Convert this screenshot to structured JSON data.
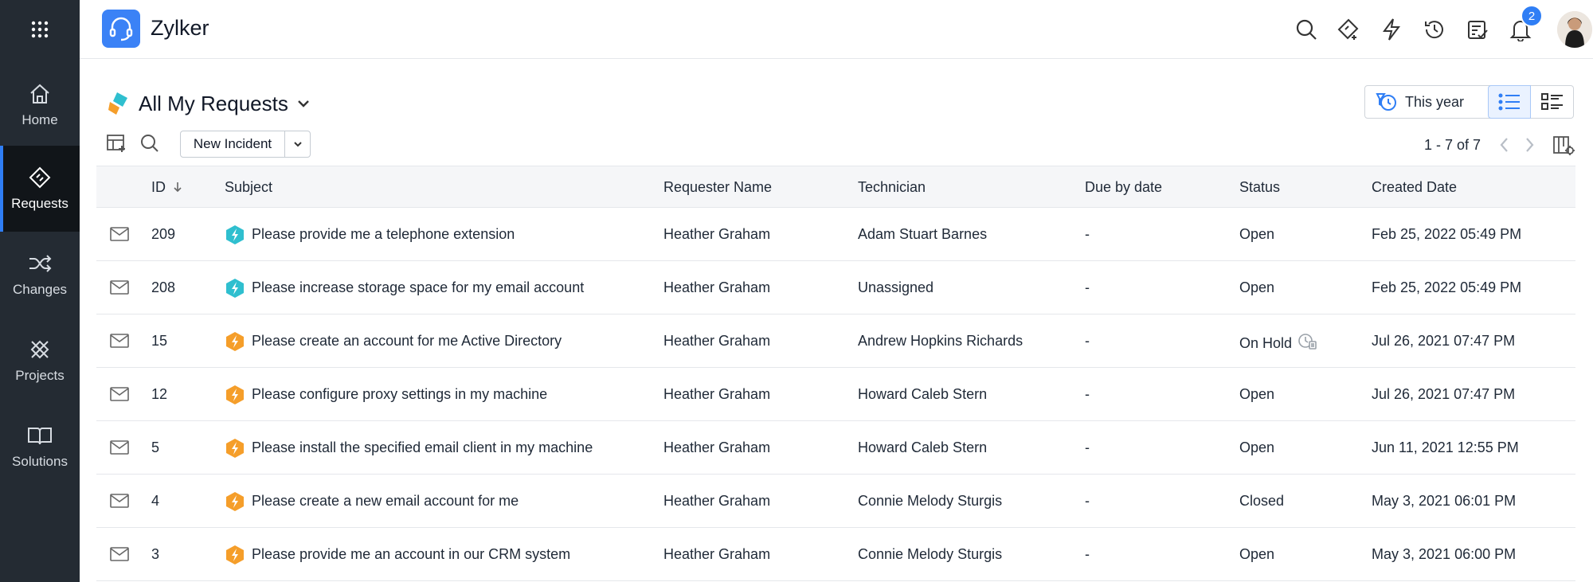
{
  "sidebar": {
    "items": [
      {
        "label": "Home"
      },
      {
        "label": "Requests"
      },
      {
        "label": "Changes"
      },
      {
        "label": "Projects"
      },
      {
        "label": "Solutions"
      }
    ]
  },
  "header": {
    "brand": "Zylker",
    "notification_count": "2"
  },
  "view": {
    "title": "All My Requests",
    "filter_label": "This year",
    "new_button": "New Incident",
    "pager": "1 - 7 of 7"
  },
  "table": {
    "columns": [
      "ID",
      "Subject",
      "Requester Name",
      "Technician",
      "Due by date",
      "Status",
      "Created Date"
    ],
    "rows": [
      {
        "id": "209",
        "subject": "Please provide me a telephone extension",
        "requester": "Heather Graham",
        "technician": "Adam Stuart Barnes",
        "due": "-",
        "status": "Open",
        "created": "Feb 25, 2022 05:49 PM",
        "type": "teal"
      },
      {
        "id": "208",
        "subject": "Please increase storage space for my email account",
        "requester": "Heather Graham",
        "technician": "Unassigned",
        "due": "-",
        "status": "Open",
        "created": "Feb 25, 2022 05:49 PM",
        "type": "teal"
      },
      {
        "id": "15",
        "subject": "Please create an account for me Active Directory",
        "requester": "Heather Graham",
        "technician": "Andrew Hopkins Richards",
        "due": "-",
        "status": "On Hold",
        "created": "Jul 26, 2021 07:47 PM",
        "type": "orange"
      },
      {
        "id": "12",
        "subject": "Please configure proxy settings in my machine",
        "requester": "Heather Graham",
        "technician": "Howard Caleb Stern",
        "due": "-",
        "status": "Open",
        "created": "Jul 26, 2021 07:47 PM",
        "type": "orange"
      },
      {
        "id": "5",
        "subject": "Please install the specified email client in my machine",
        "requester": "Heather Graham",
        "technician": "Howard Caleb Stern",
        "due": "-",
        "status": "Open",
        "created": "Jun 11, 2021 12:55 PM",
        "type": "orange"
      },
      {
        "id": "4",
        "subject": "Please create a new email account for me",
        "requester": "Heather Graham",
        "technician": "Connie Melody Sturgis",
        "due": "-",
        "status": "Closed",
        "created": "May 3, 2021 06:01 PM",
        "type": "orange"
      },
      {
        "id": "3",
        "subject": "Please provide me an account in our CRM system",
        "requester": "Heather Graham",
        "technician": "Connie Melody Sturgis",
        "due": "-",
        "status": "Open",
        "created": "May 3, 2021 06:00 PM",
        "type": "orange"
      }
    ]
  },
  "colors": {
    "sidebar_bg": "#242b33",
    "sidebar_active_bg": "#111519",
    "accent": "#2f7ef5",
    "service_request": "#2fbfcf",
    "incident": "#f59e2a"
  }
}
